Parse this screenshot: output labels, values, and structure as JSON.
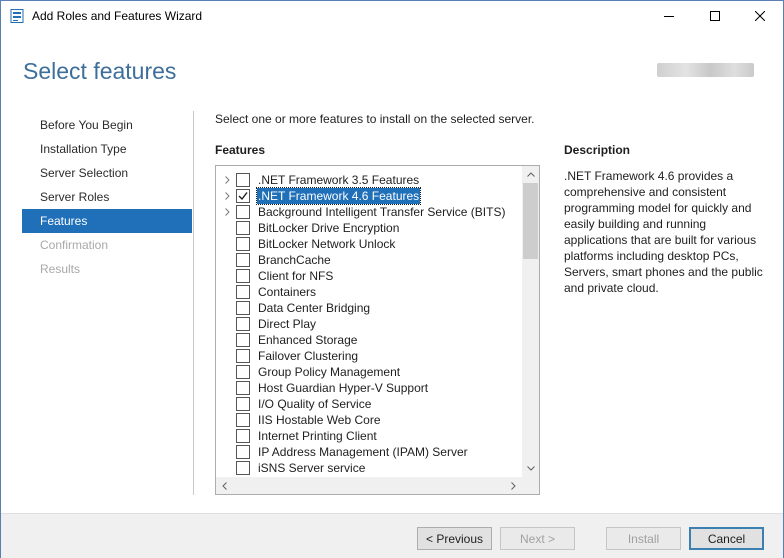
{
  "window": {
    "title": "Add Roles and Features Wizard",
    "icon": "server-manager-icon",
    "controls": [
      "minimize-icon",
      "maximize-icon",
      "close-icon"
    ]
  },
  "header": {
    "page_title": "Select features"
  },
  "nav": {
    "items": [
      {
        "label": "Before You Begin",
        "state": "normal"
      },
      {
        "label": "Installation Type",
        "state": "normal"
      },
      {
        "label": "Server Selection",
        "state": "normal"
      },
      {
        "label": "Server Roles",
        "state": "normal"
      },
      {
        "label": "Features",
        "state": "selected"
      },
      {
        "label": "Confirmation",
        "state": "disabled"
      },
      {
        "label": "Results",
        "state": "disabled"
      }
    ]
  },
  "main": {
    "instructions": "Select one or more features to install on the selected server.",
    "features_heading": "Features",
    "features": [
      {
        "label": ".NET Framework 3.5 Features",
        "expandable": true,
        "checked": false,
        "highlighted": false
      },
      {
        "label": ".NET Framework 4.6 Features",
        "expandable": true,
        "checked": true,
        "highlighted": true
      },
      {
        "label": "Background Intelligent Transfer Service (BITS)",
        "expandable": true,
        "checked": false,
        "highlighted": false
      },
      {
        "label": "BitLocker Drive Encryption",
        "expandable": false,
        "checked": false,
        "highlighted": false
      },
      {
        "label": "BitLocker Network Unlock",
        "expandable": false,
        "checked": false,
        "highlighted": false
      },
      {
        "label": "BranchCache",
        "expandable": false,
        "checked": false,
        "highlighted": false
      },
      {
        "label": "Client for NFS",
        "expandable": false,
        "checked": false,
        "highlighted": false
      },
      {
        "label": "Containers",
        "expandable": false,
        "checked": false,
        "highlighted": false
      },
      {
        "label": "Data Center Bridging",
        "expandable": false,
        "checked": false,
        "highlighted": false
      },
      {
        "label": "Direct Play",
        "expandable": false,
        "checked": false,
        "highlighted": false
      },
      {
        "label": "Enhanced Storage",
        "expandable": false,
        "checked": false,
        "highlighted": false
      },
      {
        "label": "Failover Clustering",
        "expandable": false,
        "checked": false,
        "highlighted": false
      },
      {
        "label": "Group Policy Management",
        "expandable": false,
        "checked": false,
        "highlighted": false
      },
      {
        "label": "Host Guardian Hyper-V Support",
        "expandable": false,
        "checked": false,
        "highlighted": false
      },
      {
        "label": "I/O Quality of Service",
        "expandable": false,
        "checked": false,
        "highlighted": false
      },
      {
        "label": "IIS Hostable Web Core",
        "expandable": false,
        "checked": false,
        "highlighted": false
      },
      {
        "label": "Internet Printing Client",
        "expandable": false,
        "checked": false,
        "highlighted": false
      },
      {
        "label": "IP Address Management (IPAM) Server",
        "expandable": false,
        "checked": false,
        "highlighted": false
      },
      {
        "label": "iSNS Server service",
        "expandable": false,
        "checked": false,
        "highlighted": false
      }
    ],
    "description_heading": "Description",
    "description_text": ".NET Framework 4.6 provides a comprehensive and consistent programming model for quickly and easily building and running applications that are built for various platforms including desktop PCs, Servers, smart phones and the public and private cloud."
  },
  "footer": {
    "previous_label": "< Previous",
    "next_label": "Next >",
    "install_label": "Install",
    "cancel_label": "Cancel"
  },
  "colors": {
    "title_blue": "#3d6f9a",
    "selection_blue": "#1f6fb9",
    "disabled_gray": "#a8a8a8"
  }
}
